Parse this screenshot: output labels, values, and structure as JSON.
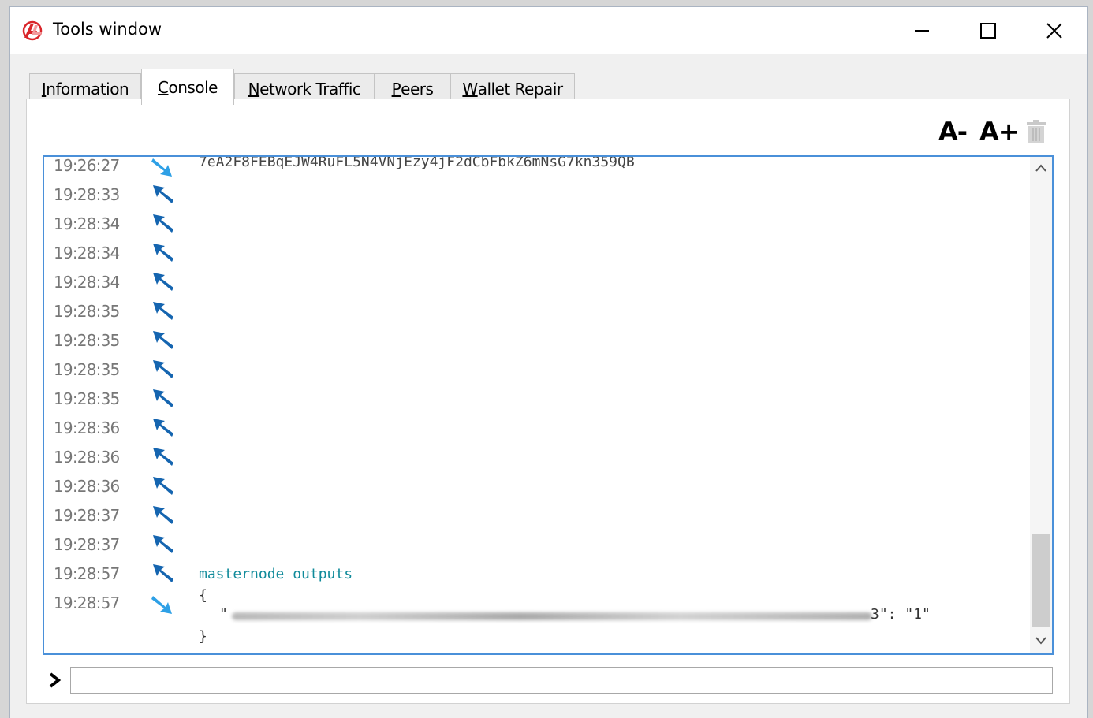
{
  "window": {
    "title": "Tools window"
  },
  "tabs": [
    {
      "label": "Information",
      "ul": "I",
      "rest": "nformation"
    },
    {
      "label": "Console",
      "ul": "C",
      "rest": "onsole"
    },
    {
      "label": "Network Traffic",
      "ul": "N",
      "rest": "etwork Traffic"
    },
    {
      "label": "Peers",
      "ul": "P",
      "rest": "eers"
    },
    {
      "label": "Wallet Repair",
      "ul": "W",
      "rest": "allet Repair"
    }
  ],
  "toolbar": {
    "font_decrease": "A-",
    "font_increase": "A+"
  },
  "console": {
    "cut_line": {
      "time": "19:26:27",
      "text": "7eA2F8FEBqEJW4RuFL5N4VNjEzy4jF2dCbFbkZ6mNsG7kn359QB"
    },
    "rows": [
      {
        "time": "19:28:33",
        "dir": "in"
      },
      {
        "time": "19:28:34",
        "dir": "in"
      },
      {
        "time": "19:28:34",
        "dir": "in"
      },
      {
        "time": "19:28:34",
        "dir": "in"
      },
      {
        "time": "19:28:35",
        "dir": "in"
      },
      {
        "time": "19:28:35",
        "dir": "in"
      },
      {
        "time": "19:28:35",
        "dir": "in"
      },
      {
        "time": "19:28:35",
        "dir": "in"
      },
      {
        "time": "19:28:36",
        "dir": "in"
      },
      {
        "time": "19:28:36",
        "dir": "in"
      },
      {
        "time": "19:28:36",
        "dir": "in"
      },
      {
        "time": "19:28:37",
        "dir": "in"
      },
      {
        "time": "19:28:37",
        "dir": "in"
      },
      {
        "time": "19:28:57",
        "dir": "in",
        "command": "masternode outputs"
      },
      {
        "time": "19:28:57",
        "dir": "out"
      }
    ],
    "output": {
      "open": "{",
      "line_prefix": "\"",
      "line_suffix": "3\": \"1\"",
      "close": "}"
    }
  },
  "input": {
    "value": "",
    "placeholder": ""
  },
  "colors": {
    "accent": "#4a90d9",
    "arrow_in": "#1565b0",
    "arrow_out": "#2ea0e6",
    "command": "#0f8a9a"
  }
}
